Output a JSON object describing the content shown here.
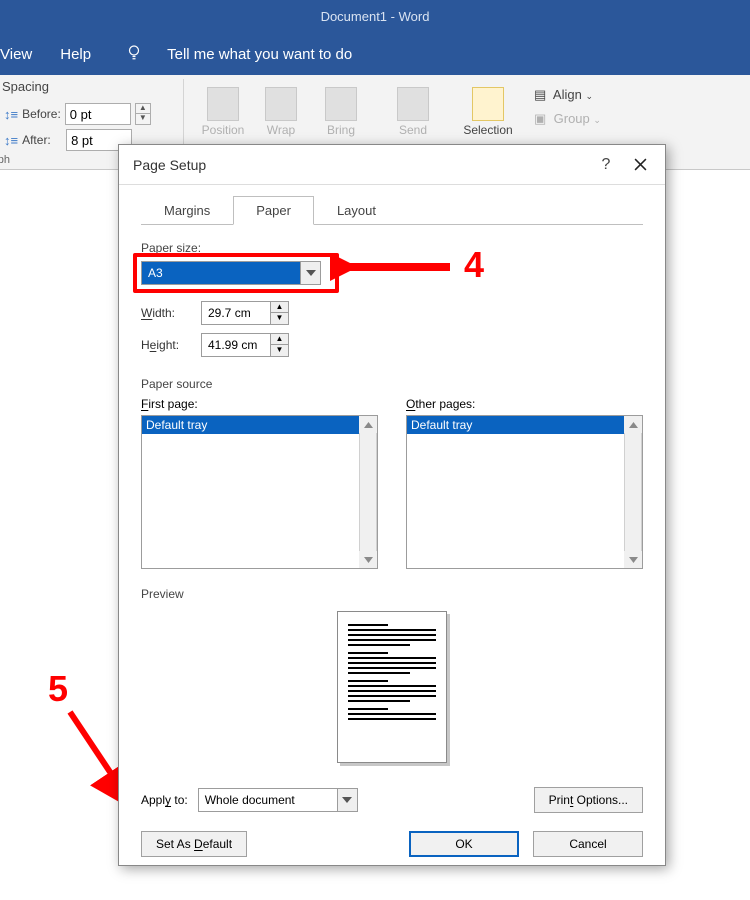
{
  "app": {
    "title": "Document1  -  Word"
  },
  "menu": {
    "view": "View",
    "help": "Help",
    "tellme": "Tell me what you want to do"
  },
  "ribbon": {
    "spacing_label": "Spacing",
    "before_label": "Before:",
    "after_label": "After:",
    "before_value": "0 pt",
    "after_value": "8 pt",
    "position": "Position",
    "wrap": "Wrap",
    "bring": "Bring",
    "send": "Send",
    "selection": "Selection",
    "align": "Align",
    "group": "Group",
    "paragraph": "raph"
  },
  "dialog": {
    "title": "Page Setup",
    "tabs": {
      "margins": "Margins",
      "paper": "Paper",
      "layout": "Layout"
    },
    "paper_size_label": "Paper size:",
    "paper_size_value": "A3",
    "width_label": "Width:",
    "height_label": "Height:",
    "width_value": "29.7 cm",
    "height_value": "41.99 cm",
    "paper_source_label": "Paper source",
    "first_page_label": "First page:",
    "other_pages_label": "Other pages:",
    "tray_value": "Default tray",
    "preview_label": "Preview",
    "apply_to_label": "Apply to:",
    "apply_to_value": "Whole document",
    "print_options": "Print Options...",
    "set_default": "Set As Default",
    "ok": "OK",
    "cancel": "Cancel"
  },
  "annotations": {
    "n4": "4",
    "n5": "5"
  }
}
